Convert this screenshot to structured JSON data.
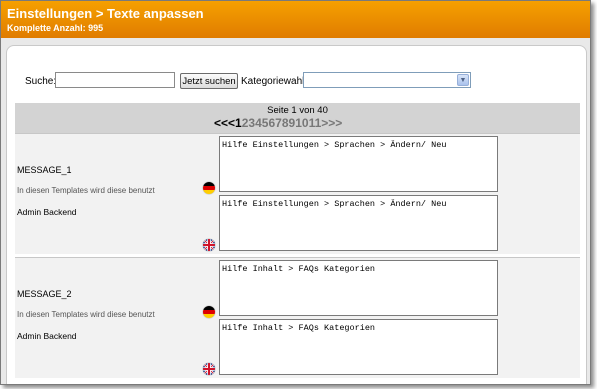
{
  "header": {
    "title": "Einstellungen > Texte anpassen",
    "count": "Komplette Anzahl: 995"
  },
  "search": {
    "label": "Suche:",
    "value": "",
    "button": "Jetzt suchen",
    "category_label": "Kategoriewahl",
    "category_value": ""
  },
  "pager": {
    "info": "Seite 1 von 40",
    "first": "<<",
    "prev": "<",
    "pages": [
      "1",
      "2",
      "3",
      "4",
      "5",
      "6",
      "7",
      "8",
      "9",
      "10",
      "11"
    ],
    "current_page": "1",
    "next": ">",
    "last": ">>"
  },
  "records": [
    {
      "key": "MESSAGE_1",
      "note": "In diesen Templates wird diese benutzt",
      "app": "Admin Backend",
      "de_text": "Hilfe Einstellungen > Sprachen > Ändern/ Neu",
      "en_text": "Hilfe Einstellungen > Sprachen > Ändern/ Neu"
    },
    {
      "key": "MESSAGE_2",
      "note": "In diesen Templates wird diese benutzt",
      "app": "Admin Backend",
      "de_text": "Hilfe Inhalt > FAQs Kategorien",
      "en_text": "Hilfe Inhalt > FAQs Kategorien"
    }
  ],
  "colors": {
    "header_top": "#f6a000",
    "header_bottom": "#e07c00",
    "pager_background": "#d3d3d3",
    "record_background": "#f2f2f2"
  },
  "icons": {
    "german_flag": "flag-de-icon",
    "english_flag": "flag-gb-icon",
    "select_arrow": "chevron-down-icon"
  }
}
